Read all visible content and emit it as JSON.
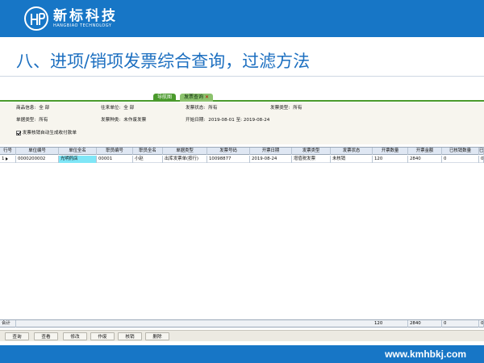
{
  "brand": {
    "name_cn": "新标科技",
    "name_en": "HANGBIAO TECHNOLOGY"
  },
  "slide_title": "八、进项/销项发票综合查询，过滤方法",
  "tabs": {
    "nav": "导航图",
    "active": "发票查询",
    "close": "✕"
  },
  "filters": {
    "product_info_label": "商品信息:",
    "product_info_value": "全  部",
    "partner_label": "往来单位:",
    "partner_value": "全  部",
    "invoice_status_label": "发票状态:",
    "invoice_status_value": "所有",
    "invoice_type_label": "发票类型:",
    "invoice_type_value": "所有",
    "doc_type_label": "单据类型:",
    "doc_type_value": "所有",
    "invoice_kind_label": "发票种类:",
    "invoice_kind_value": "未作废发票",
    "date_label": "开始日期:",
    "date_from": "2019-08-01",
    "date_to_label": "至:",
    "date_to": "2019-08-24",
    "auto_checkbox_label": "发票核销自动生成收付款单",
    "auto_checkbox_checked": true
  },
  "grid": {
    "columns": [
      "行号",
      "单位编号",
      "单位全名",
      "职员编号",
      "职员全名",
      "单据类型",
      "发票号码",
      "开票日期",
      "发票类型",
      "发票状态",
      "开票数量",
      "开票金额",
      "已核销数量",
      "已"
    ],
    "rows": [
      {
        "row_no": "1",
        "unit_code": "0000200002",
        "unit_name": "光明药店",
        "staff_code": "00001",
        "staff_name": "小赵",
        "doc_type": "出库发票单(按行)",
        "invoice_no": "10098877",
        "invoice_date": "2019-08-24",
        "invoice_type": "增值税发票",
        "invoice_status": "未核销",
        "qty": "120",
        "amount": "2840",
        "written_off_qty": "0",
        "extra": "0"
      }
    ],
    "totals": {
      "label": "合计",
      "qty": "120",
      "amount": "2840",
      "written_off_qty": "0",
      "extra": "0"
    }
  },
  "buttons": [
    "查询",
    "查看",
    "修改",
    "作废",
    "核销",
    "删除"
  ],
  "footer_site": "www.kmhbkj.com",
  "colors": {
    "brand_blue": "#1776c6",
    "title_blue": "#1c6fc0",
    "tab_green": "#4a9a2c",
    "highlight_cell": "#7fe6f7"
  }
}
